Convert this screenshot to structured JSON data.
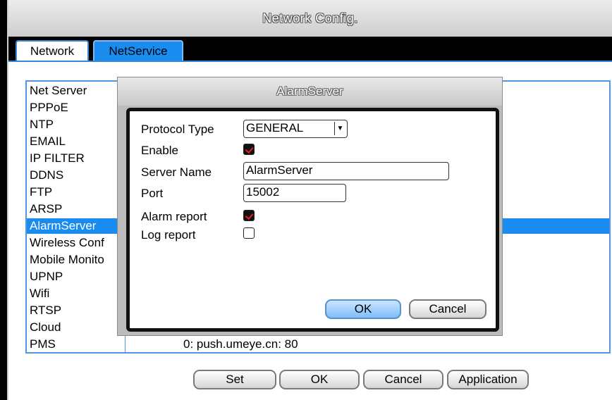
{
  "window": {
    "title": "Network Config."
  },
  "tabs": [
    {
      "label": "Network"
    },
    {
      "label": "NetService"
    }
  ],
  "list": {
    "items": [
      {
        "name": "Net Server",
        "info": ""
      },
      {
        "name": "PPPoE",
        "info": ""
      },
      {
        "name": "NTP",
        "info": ""
      },
      {
        "name": "EMAIL",
        "info": ""
      },
      {
        "name": "IP FILTER",
        "info": ""
      },
      {
        "name": "DDNS",
        "info": ""
      },
      {
        "name": "FTP",
        "info": ""
      },
      {
        "name": "ARSP",
        "info": ""
      },
      {
        "name": "AlarmServer",
        "info": ""
      },
      {
        "name": "Wireless Conf",
        "info": ""
      },
      {
        "name": "Mobile Monito",
        "info": ""
      },
      {
        "name": "UPNP",
        "info": ""
      },
      {
        "name": "Wifi",
        "info": ""
      },
      {
        "name": "RTSP",
        "info": ""
      },
      {
        "name": "Cloud",
        "info": ""
      },
      {
        "name": "PMS",
        "info": "0: push.umeye.cn: 80"
      }
    ],
    "selected": "AlarmServer"
  },
  "buttons": {
    "set": "Set",
    "ok": "OK",
    "cancel": "Cancel",
    "application": "Application"
  },
  "dialog": {
    "title": "AlarmServer",
    "protocol_type_label": "Protocol Type",
    "protocol_type_value": "GENERAL",
    "enable_label": "Enable",
    "enable_checked": true,
    "server_name_label": "Server Name",
    "server_name_value": "AlarmServer",
    "port_label": "Port",
    "port_value": "15002",
    "alarm_report_label": "Alarm report",
    "alarm_report_checked": true,
    "log_report_label": "Log report",
    "log_report_checked": false,
    "ok_label": "OK",
    "cancel_label": "Cancel"
  },
  "colors": {
    "accent": "#1a8cf0",
    "check_mark": "#e02020"
  }
}
